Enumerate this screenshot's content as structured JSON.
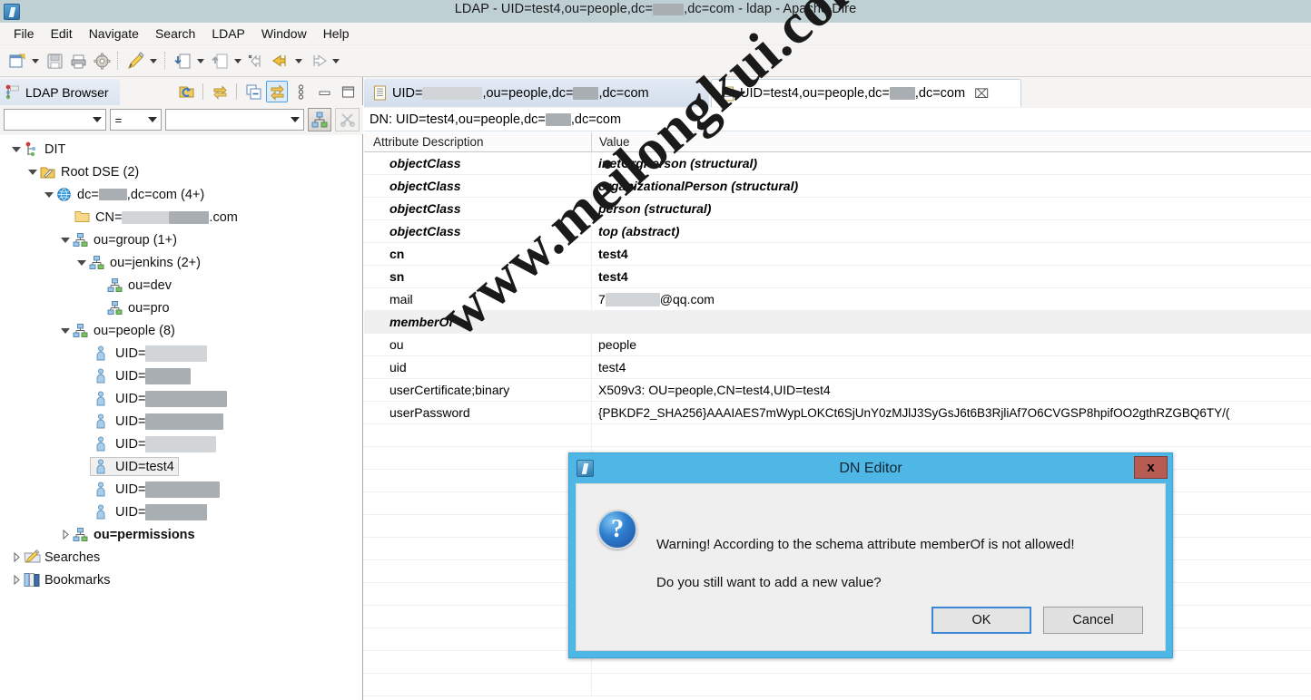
{
  "window": {
    "title_prefix": "LDAP - UID=test4,ou=people,dc=",
    "title_suffix": ",dc=com - ldap - Apache Dire",
    "icon": "app-icon"
  },
  "menubar": {
    "items": [
      "File",
      "Edit",
      "Navigate",
      "Search",
      "LDAP",
      "Window",
      "Help"
    ]
  },
  "toolbar": {
    "items": [
      "new-entry-icon",
      "new-dropdown-caret",
      "save-icon",
      "print-icon",
      "properties-icon",
      "sep1",
      "edit-pencil-icon",
      "edit-dropdown-caret",
      "sep2",
      "import-icon",
      "import-dropdown-caret",
      "export-icon",
      "export-dropdown-caret",
      "back-small-icon",
      "back-icon",
      "back-dropdown-caret",
      "forward-icon",
      "forward-dropdown-caret"
    ]
  },
  "left_panel": {
    "tab_label": "LDAP Browser",
    "tab_icon": "ldap-browser-icon",
    "tools": [
      "refresh-icon",
      "sync-icon",
      "collapse-all-icon",
      "link-with-editor-icon",
      "view-menu-icon",
      "minimize-icon",
      "maximize-icon"
    ],
    "filter": {
      "attribute_value": "",
      "operator_value": "=",
      "value_value": "",
      "apply_icon": "apply-filter-icon",
      "clear_icon": "clear-filter-icon"
    },
    "tree": [
      {
        "label": "DIT",
        "indent": 0,
        "twisty": "down",
        "icon": "dit-icon"
      },
      {
        "label": "Root DSE (2)",
        "indent": 1,
        "twisty": "down",
        "icon": "rootdse-icon"
      },
      {
        "label": "dc=███,dc=com (4+)",
        "indent": 2,
        "twisty": "down",
        "icon": "globe-icon",
        "prefix": "dc=",
        "suffix": ",dc=com (4+)",
        "redact": "wide-sm"
      },
      {
        "label": "CN=██████.com",
        "indent": 3,
        "twisty": "none",
        "icon": "folder-icon",
        "prefix": "CN=",
        "suffix": ".com",
        "redact": "wide-lg"
      },
      {
        "label": "ou=group (1+)",
        "indent": 2,
        "twisty": "down",
        "icon": "ou-icon"
      },
      {
        "label": "ou=jenkins (2+)",
        "indent": 3,
        "twisty": "down",
        "icon": "ou-icon"
      },
      {
        "label": "ou=dev",
        "indent": 4,
        "twisty": "none",
        "icon": "ou-icon"
      },
      {
        "label": "ou=pro",
        "indent": 4,
        "twisty": "none",
        "icon": "ou-icon"
      },
      {
        "label": "ou=people (8)",
        "indent": 2,
        "twisty": "down",
        "icon": "ou-icon"
      },
      {
        "label": "UID=",
        "indent": 3,
        "twisty": "none",
        "icon": "person-icon",
        "redact": "u1"
      },
      {
        "label": "UID=",
        "indent": 3,
        "twisty": "none",
        "icon": "person-icon",
        "redact": "u2"
      },
      {
        "label": "UID=",
        "indent": 3,
        "twisty": "none",
        "icon": "person-icon",
        "redact": "u3"
      },
      {
        "label": "UID=",
        "indent": 3,
        "twisty": "none",
        "icon": "person-icon",
        "redact": "u4"
      },
      {
        "label": "UID=",
        "indent": 3,
        "twisty": "none",
        "icon": "person-icon",
        "redact": "u5"
      },
      {
        "label": "UID=test4",
        "indent": 3,
        "twisty": "none",
        "icon": "person-icon",
        "selected": true
      },
      {
        "label": "UID=",
        "indent": 3,
        "twisty": "none",
        "icon": "person-icon",
        "redact": "u6"
      },
      {
        "label": "UID=",
        "indent": 3,
        "twisty": "none",
        "icon": "person-icon",
        "redact": "u7"
      },
      {
        "label": "ou=permissions",
        "indent": 2,
        "twisty": "right",
        "icon": "ou-icon"
      },
      {
        "label": "Searches",
        "indent": 0,
        "twisty": "right",
        "icon": "searches-icon"
      },
      {
        "label": "Bookmarks",
        "indent": 0,
        "twisty": "right",
        "icon": "bookmarks-icon"
      }
    ]
  },
  "editor": {
    "tabs": [
      {
        "prefix": "UID=",
        "redact": "tab1",
        "suffix": ",ou=people,dc=",
        "redact2": "tabdc",
        "suffix2": ",dc=com",
        "active": false,
        "icon": "entry-icon",
        "closable": false
      },
      {
        "prefix": "UID=test4,ou=people,dc=",
        "redact2": "tabdc",
        "suffix2": ",dc=com",
        "active": true,
        "icon": "entry-icon",
        "closable": true,
        "close_glyph": "⌧"
      }
    ],
    "dn_label": "DN: UID=test4,ou=people,dc=",
    "dn_suffix": ",dc=com",
    "table": {
      "headers": [
        "Attribute Description",
        "Value"
      ],
      "rows": [
        {
          "attr": "objectClass",
          "value": "inetOrgPerson (structural)",
          "style": "oc"
        },
        {
          "attr": "objectClass",
          "value": "organizationalPerson (structural)",
          "style": "oc"
        },
        {
          "attr": "objectClass",
          "value": "person (structural)",
          "style": "oc"
        },
        {
          "attr": "objectClass",
          "value": "top (abstract)",
          "style": "oc"
        },
        {
          "attr": "cn",
          "value": "test4",
          "style": "bold"
        },
        {
          "attr": "sn",
          "value": "test4",
          "style": "bold"
        },
        {
          "attr": "mail",
          "value": "7████@qq.com",
          "style": "normal",
          "value_prefix": "7",
          "value_suffix": "@qq.com",
          "redact": "mail"
        },
        {
          "attr": "memberOf",
          "value": "",
          "style": "oc",
          "highlight": true
        },
        {
          "attr": "ou",
          "value": "people",
          "style": "normal"
        },
        {
          "attr": "uid",
          "value": "test4",
          "style": "normal"
        },
        {
          "attr": "userCertificate;binary",
          "value": "X509v3: OU=people,CN=test4,UID=test4",
          "style": "normal"
        },
        {
          "attr": "userPassword",
          "value": "{PBKDF2_SHA256}AAAIAES7mWypLOKCt6SjUnY0zMJlJ3SyGsJ6t6B3RjliAf7O6CVGSP8hpifOO2gthRZGBQ6TY/(",
          "style": "normal"
        }
      ],
      "empty_rows": 11
    }
  },
  "watermark": {
    "text": "www.meilongkui.com"
  },
  "dialog": {
    "title": "DN Editor",
    "close_label": "x",
    "icon": "question-icon",
    "question_glyph": "?",
    "line1": "Warning! According to the schema attribute memberOf is not allowed!",
    "line2": "Do you still want to add a new value?",
    "ok_label": "OK",
    "cancel_label": "Cancel"
  },
  "colors": {
    "titlebar": "#bfd0d4",
    "dialog_frame": "#4fb7e5",
    "dialog_close": "#b85b53",
    "accent_focus": "#3b87d6",
    "highlight_row": "#f0f0f0"
  }
}
